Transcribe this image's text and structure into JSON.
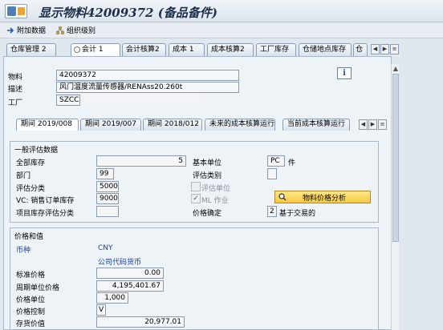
{
  "window": {
    "title": "显示物料42009372 (备品备件)"
  },
  "toolbar": {
    "additional_data": "附加数据",
    "org_levels": "组织级别"
  },
  "main_tabs": {
    "labels": [
      "仓库管理 2",
      "会计 1",
      "会计核算2",
      "成本 1",
      "成本核算2",
      "工厂库存",
      "仓储地点库存",
      "仓"
    ],
    "active": "会计 1"
  },
  "header": {
    "material_label": "物料",
    "material_value": "42009372",
    "desc_label": "描述",
    "desc_value": "风门温度流量传感器/RENAss20.260t",
    "plant_label": "工厂",
    "plant_value": "SZCC"
  },
  "sub_tabs": {
    "labels": [
      "期间 2019/008",
      "期间 2019/007",
      "期间 2018/012",
      "未来的成本核算运行",
      "当前成本核算运行"
    ],
    "active": "期间 2019/008"
  },
  "general_valuation": {
    "title": "一般评估数据",
    "base_qty_label": "全部库存",
    "base_qty_value": "5",
    "base_unit_label": "基本单位",
    "base_unit_value": "PC",
    "base_unit_text": "件",
    "division_label": "部门",
    "division_value": "99",
    "valuation_cat_label": "评估类别",
    "valuation_class_label": "评估分类",
    "valuation_class_value": "5000",
    "valuated_unit_label": "评估单位",
    "vc_label": "VC: 销售订单库存",
    "vc_value": "9000",
    "ml_label": "ML 作业",
    "ml_checked": true,
    "analysis_button": "物料价格分析",
    "project_label": "项目库存评估分类",
    "price_det_label": "价格确定",
    "price_det_value": "2",
    "price_det_text": "基于交易的"
  },
  "prices": {
    "title": "价格和值",
    "currency_label": "币种",
    "currency_value": "CNY",
    "company_currency": "公司代码货币",
    "std_price_label": "标准价格",
    "std_price_value": "0.00",
    "periodic_price_label": "周期单位价格",
    "periodic_price_value": "4,195,401.67",
    "price_unit_label": "价格单位",
    "price_unit_value": "1,000",
    "price_control_label": "价格控制",
    "price_control_value": "V",
    "stock_value_label": "存货价值",
    "stock_value_value": "20,977.01"
  },
  "colors": {
    "accent": "#2653a6",
    "button_yellow": "#f6c944",
    "background": "#dfe7ef"
  }
}
